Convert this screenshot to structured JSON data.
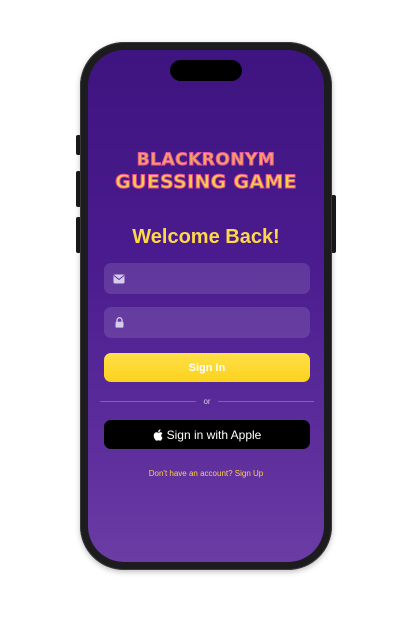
{
  "app": {
    "logo_line1": "BLACKRONYM",
    "logo_line2": "GUESSING GAME"
  },
  "login": {
    "title": "Welcome Back!",
    "email": {
      "icon": "mail-icon",
      "value": "",
      "placeholder": ""
    },
    "password": {
      "icon": "lock-icon",
      "value": "",
      "placeholder": ""
    },
    "sign_in_label": "Sign In",
    "divider_label": "or",
    "apple_label": "Sign in with Apple",
    "signup_link": "Don't have an account? Sign Up"
  },
  "colors": {
    "accent": "#ffd84a",
    "button": "#fcd21c",
    "background_top": "#3e1480",
    "background_bottom": "#6b3ca4"
  }
}
